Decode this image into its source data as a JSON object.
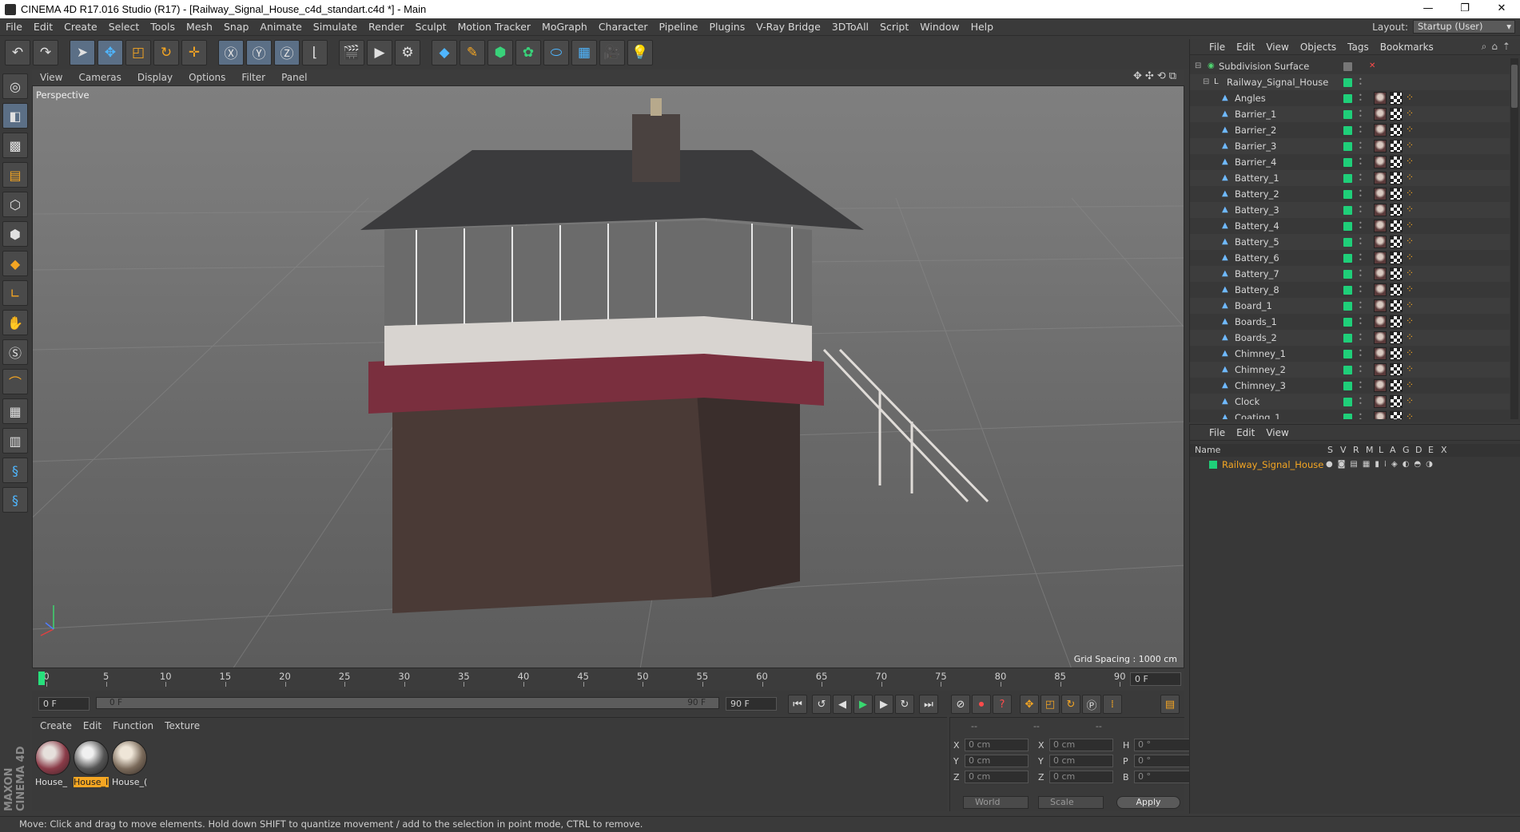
{
  "window": {
    "title": "CINEMA 4D R17.016 Studio (R17) - [Railway_Signal_House_c4d_standart.c4d *] - Main",
    "controls": [
      "—",
      "❐",
      "✕"
    ]
  },
  "menubar": {
    "items": [
      "File",
      "Edit",
      "Create",
      "Select",
      "Tools",
      "Mesh",
      "Snap",
      "Animate",
      "Simulate",
      "Render",
      "Sculpt",
      "Motion Tracker",
      "MoGraph",
      "Character",
      "Pipeline",
      "Plugins",
      "V-Ray Bridge",
      "3DToAll",
      "Script",
      "Window",
      "Help"
    ],
    "layout_label": "Layout:",
    "layout_value": "Startup (User)"
  },
  "toolbar": {
    "icons": [
      "undo-icon",
      "redo-icon",
      "select-arrow-icon",
      "move-icon",
      "scale-icon",
      "rotate-icon",
      "transform-icon",
      "x-axis-icon",
      "y-axis-icon",
      "z-axis-icon",
      "coordinate-system-icon",
      "render-view-icon",
      "render-picture-viewer-icon",
      "render-settings-icon",
      "cube-icon",
      "pen-spline-icon",
      "nurbs-icon",
      "array-icon",
      "deformer-icon",
      "floor-icon",
      "camera-icon",
      "light-icon"
    ]
  },
  "viewport": {
    "menu": [
      "View",
      "Cameras",
      "Display",
      "Options",
      "Filter",
      "Panel"
    ],
    "label": "Perspective",
    "grid_spacing": "Grid Spacing : 1000 cm"
  },
  "timeline": {
    "ticks": [
      "0",
      "5",
      "10",
      "15",
      "20",
      "25",
      "30",
      "35",
      "40",
      "45",
      "50",
      "55",
      "60",
      "65",
      "70",
      "75",
      "80",
      "85",
      "90"
    ],
    "current_frame": "0 F"
  },
  "transport": {
    "start_field": "0 F",
    "slider_start": "0 F",
    "slider_end": "90 F",
    "end_field": "90 F"
  },
  "material_manager": {
    "menu": [
      "Create",
      "Edit",
      "Function",
      "Texture"
    ],
    "materials": [
      {
        "label": "House_",
        "selected": false
      },
      {
        "label": "House_I",
        "selected": true
      },
      {
        "label": "House_(",
        "selected": false
      }
    ]
  },
  "coordinates": {
    "header": [
      "--",
      "--",
      "--"
    ],
    "rows": [
      {
        "a1": "X",
        "v1": "0 cm",
        "a2": "X",
        "v2": "0 cm",
        "a3": "H",
        "v3": "0 °"
      },
      {
        "a1": "Y",
        "v1": "0 cm",
        "a2": "Y",
        "v2": "0 cm",
        "a3": "P",
        "v3": "0 °"
      },
      {
        "a1": "Z",
        "v1": "0 cm",
        "a2": "Z",
        "v2": "0 cm",
        "a3": "B",
        "v3": "0 °"
      }
    ],
    "mode": "World",
    "scale": "Scale",
    "apply": "Apply"
  },
  "status": {
    "text": "Move: Click and drag to move elements. Hold down SHIFT to quantize movement / add to the selection in point mode, CTRL to remove."
  },
  "object_manager": {
    "menu": [
      "File",
      "Edit",
      "View",
      "Objects",
      "Tags",
      "Bookmarks"
    ],
    "root": "Subdivision Surface",
    "group": "Railway_Signal_House",
    "objects": [
      "Angles",
      "Barrier_1",
      "Barrier_2",
      "Barrier_3",
      "Barrier_4",
      "Battery_1",
      "Battery_2",
      "Battery_3",
      "Battery_4",
      "Battery_5",
      "Battery_6",
      "Battery_7",
      "Battery_8",
      "Board_1",
      "Boards_1",
      "Boards_2",
      "Chimney_1",
      "Chimney_2",
      "Chimney_3",
      "Clock",
      "Coating_1"
    ]
  },
  "attribute_manager": {
    "menu": [
      "File",
      "Edit",
      "View"
    ],
    "columns": [
      "Name",
      "S",
      "V",
      "R",
      "M",
      "L",
      "A",
      "G",
      "D",
      "E",
      "X"
    ],
    "row_name": "Railway_Signal_House"
  },
  "colors": {
    "accent": "#f5a623",
    "visible_green": "#1fcf79",
    "playhead": "#27e07c"
  }
}
